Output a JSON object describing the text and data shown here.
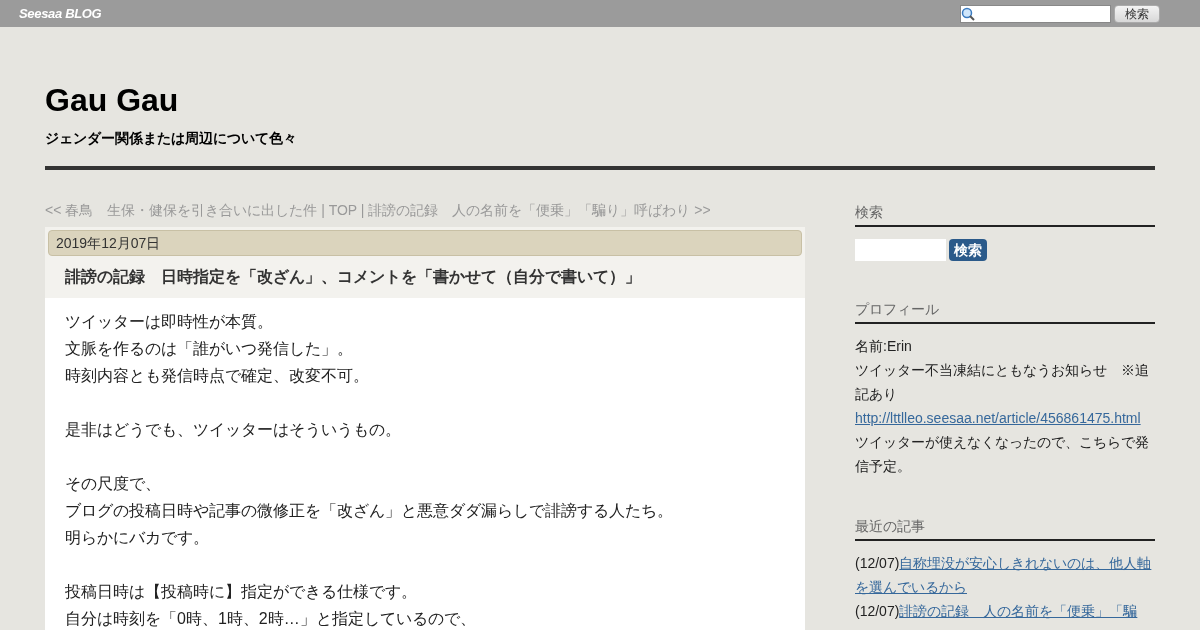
{
  "topbar": {
    "logo": "Seesaa BLOG",
    "search_button": "検索"
  },
  "blog": {
    "title": "Gau Gau",
    "subtitle": "ジェンダー関係または周辺について色々"
  },
  "nav": {
    "prev": "<< 春鳥　生保・健保を引き合いに出した件",
    "separator_1": "|",
    "top": "TOP",
    "separator_2": "|",
    "next": "誹謗の記録　人の名前を「便乗」「騙り」呼ばわり >>"
  },
  "article": {
    "date": "2019年12月07日",
    "title": "誹謗の記録　日時指定を「改ざん」、コメントを「書かせて（自分で書いて）」",
    "paragraphs": [
      [
        "ツイッターは即時性が本質。",
        "文脈を作るのは「誰がいつ発信した」。",
        "時刻内容とも発信時点で確定、改変不可。"
      ],
      [
        "是非はどうでも、ツイッターはそういうもの。"
      ],
      [
        "その尺度で、",
        "ブログの投稿日時や記事の微修正を「改ざん」と悪意ダダ漏らしで誹謗する人たち。",
        "明らかにバカです。"
      ],
      [
        "投稿日時は【投稿時に】指定ができる仕様です。",
        "自分は時刻を「0時、1時、2時…」と指定しているので、"
      ]
    ]
  },
  "sidebar": {
    "search": {
      "heading": "検索",
      "button": "検索"
    },
    "profile": {
      "heading": "プロフィール",
      "name": "名前:Erin",
      "notice": "ツイッター不当凍結にともなうお知らせ　※追記あり",
      "link": "http://lttlleo.seesaa.net/article/456861475.html",
      "note": "ツイッターが使えなくなったので、こちらで発信予定。"
    },
    "recent": {
      "heading": "最近の記事",
      "items": [
        {
          "date": "(12/07)",
          "title": "自称埋没が安心しきれないのは、他人軸を選んでいるから"
        },
        {
          "date": "(12/07)",
          "title": "誹謗の記録　人の名前を「便乗」「騙"
        }
      ]
    }
  }
}
